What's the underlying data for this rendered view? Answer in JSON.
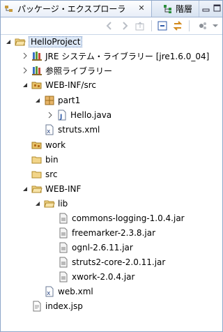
{
  "tabs": {
    "active": "パッケージ・エクスプローラ",
    "inactive": "階層"
  },
  "tree": {
    "project": "HelloProject",
    "jre": "JRE システム・ライブラリー [jre1.6.0_04]",
    "reflib": "参照ライブラリー",
    "webinf_src": "WEB-INF/src",
    "pkg": "part1",
    "hello": "Hello.java",
    "struts_xml": "struts.xml",
    "work": "work",
    "bin": "bin",
    "src": "src",
    "webinf": "WEB-INF",
    "lib": "lib",
    "jar1": "commons-logging-1.0.4.jar",
    "jar2": "freemarker-2.3.8.jar",
    "jar3": "ognl-2.6.11.jar",
    "jar4": "struts2-core-2.0.11.jar",
    "jar5": "xwork-2.0.4.jar",
    "web_xml": "web.xml",
    "index": "index.jsp"
  }
}
